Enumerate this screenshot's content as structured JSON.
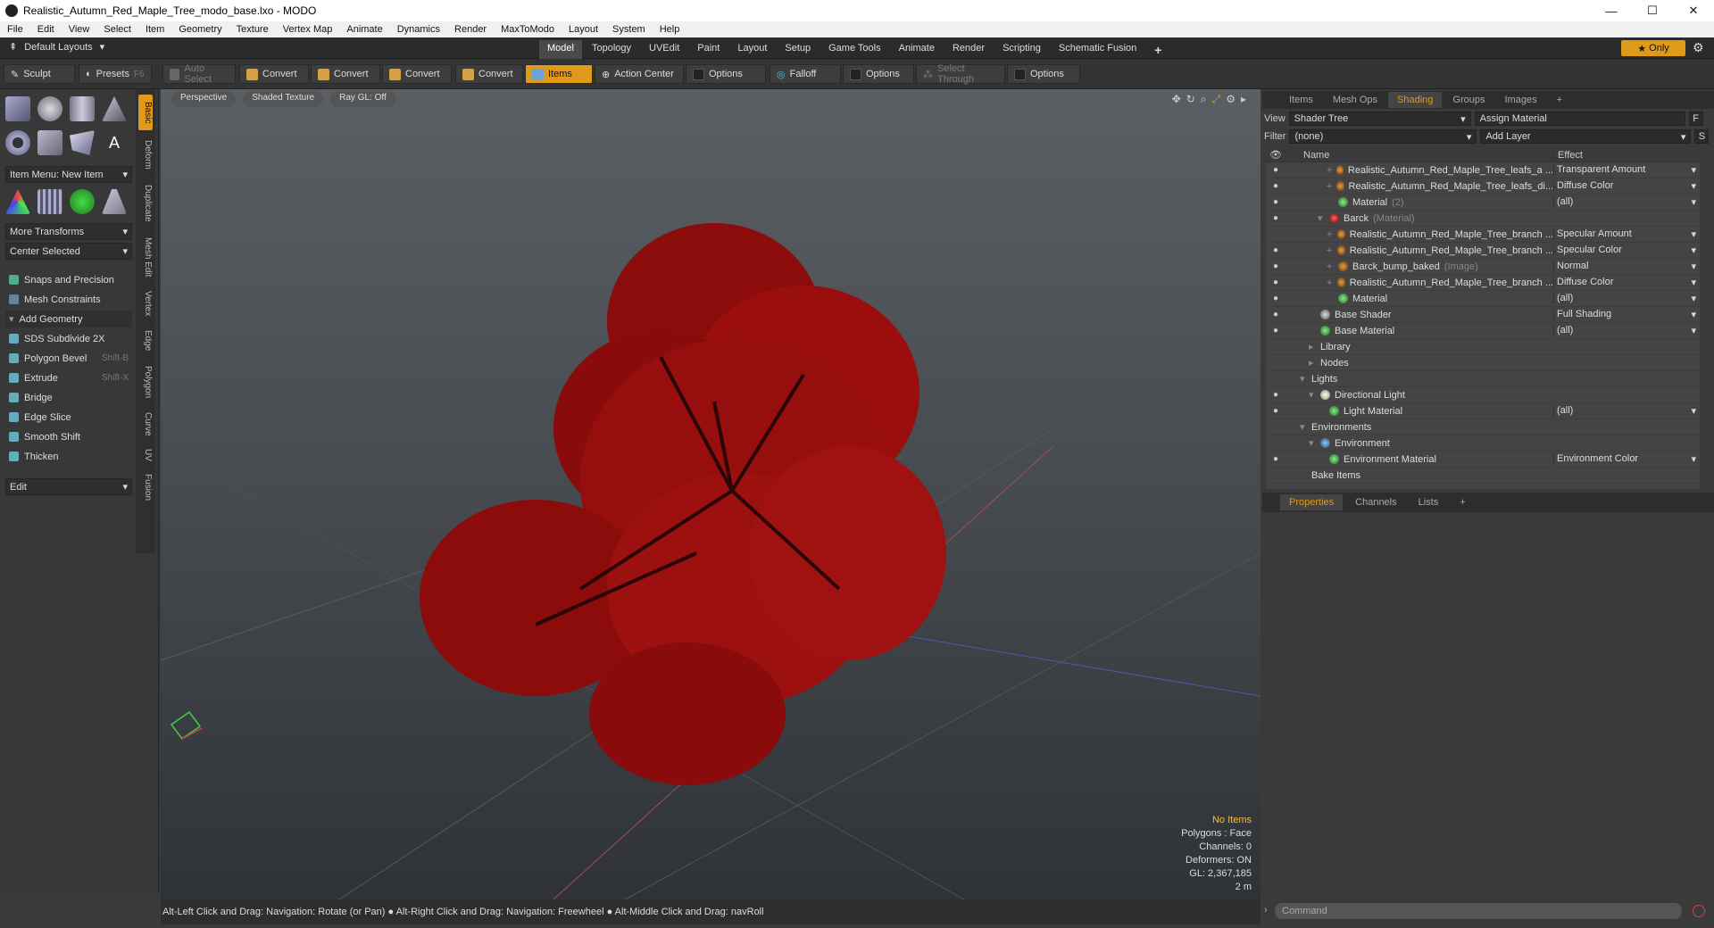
{
  "window": {
    "title": "Realistic_Autumn_Red_Maple_Tree_modo_base.lxo - MODO",
    "minimize": "—",
    "maximize": "☐",
    "close": "✕"
  },
  "menu": [
    "File",
    "Edit",
    "View",
    "Select",
    "Item",
    "Geometry",
    "Texture",
    "Vertex Map",
    "Animate",
    "Dynamics",
    "Render",
    "MaxToModo",
    "Layout",
    "System",
    "Help"
  ],
  "layouts": {
    "label": "Default Layouts",
    "tabs": [
      "Model",
      "Topology",
      "UVEdit",
      "Paint",
      "Layout",
      "Setup",
      "Game Tools",
      "Animate",
      "Render",
      "Scripting",
      "Schematic Fusion"
    ],
    "active": "Model",
    "add": "+",
    "only": "Only"
  },
  "toolbar": {
    "sculpt": "Sculpt",
    "presets": "Presets",
    "presets_key": "F6",
    "auto_select": "Auto Select",
    "convert1": "Convert",
    "convert2": "Convert",
    "convert3": "Convert",
    "convert4": "Convert",
    "items": "Items",
    "action_center": "Action Center",
    "options1": "Options",
    "falloff": "Falloff",
    "options2": "Options",
    "select_through": "Select Through",
    "options3": "Options"
  },
  "left": {
    "vtabs": [
      "Basic",
      "Deform",
      "Duplicate",
      "Mesh Edit",
      "Vertex",
      "Edge",
      "Polygon",
      "Curve",
      "UV",
      "Fusion"
    ],
    "item_menu": "Item Menu: New Item",
    "more_transforms": "More Transforms",
    "center_selected": "Center Selected",
    "snaps": "Snaps and Precision",
    "mesh_constraints": "Mesh Constraints",
    "add_geometry": "Add Geometry",
    "tools": [
      {
        "label": "SDS Subdivide 2X",
        "key": ""
      },
      {
        "label": "Polygon Bevel",
        "key": "Shift-B"
      },
      {
        "label": "Extrude",
        "key": "Shift-X"
      },
      {
        "label": "Bridge",
        "key": ""
      },
      {
        "label": "Edge Slice",
        "key": ""
      },
      {
        "label": "Smooth Shift",
        "key": ""
      },
      {
        "label": "Thicken",
        "key": ""
      }
    ],
    "edit": "Edit"
  },
  "viewport": {
    "perspective": "Perspective",
    "shading": "Shaded Texture",
    "raygl": "Ray GL: Off",
    "hud": {
      "items": "No Items",
      "polygons": "Polygons : Face",
      "channels": "Channels: 0",
      "deformers": "Deformers: ON",
      "gl": "GL: 2,367,185",
      "scale": "2 m"
    }
  },
  "status": "Alt-Left Click and Drag: Navigation: Rotate (or Pan) ● Alt-Right Click and Drag: Navigation: Freewheel ● Alt-Middle Click and Drag: navRoll",
  "right": {
    "tabs": [
      "Items",
      "Mesh Ops",
      "Shading",
      "Groups",
      "Images"
    ],
    "active_tab": "Shading",
    "view_label": "View",
    "view_value": "Shader Tree",
    "assign_material": "Assign Material",
    "f_btn": "F",
    "filter_label": "Filter",
    "filter_value": "(none)",
    "add_layer": "Add Layer",
    "s_btn": "S",
    "col_name": "Name",
    "col_effect": "Effect",
    "rows": [
      {
        "indent": 4,
        "name": "Realistic_Autumn_Red_Maple_Tree_leafs_a ...",
        "sub": "",
        "effect": "Transparent Amount",
        "kind": "tex",
        "eye": true
      },
      {
        "indent": 4,
        "name": "Realistic_Autumn_Red_Maple_Tree_leafs_di...",
        "sub": "",
        "effect": "Diffuse Color",
        "kind": "tex",
        "eye": true
      },
      {
        "indent": 4,
        "name": "Material",
        "sub": "(2)",
        "effect": "(all)",
        "kind": "mat",
        "eye": true
      },
      {
        "indent": 3,
        "name": "Barck",
        "sub": "(Material)",
        "effect": "",
        "kind": "grp",
        "eye": true
      },
      {
        "indent": 4,
        "name": "Realistic_Autumn_Red_Maple_Tree_branch ...",
        "sub": "",
        "effect": "Specular Amount",
        "kind": "tex",
        "eye": false
      },
      {
        "indent": 4,
        "name": "Realistic_Autumn_Red_Maple_Tree_branch ...",
        "sub": "",
        "effect": "Specular Color",
        "kind": "tex",
        "eye": true
      },
      {
        "indent": 4,
        "name": "Barck_bump_baked",
        "sub": "(Image)",
        "effect": "Normal",
        "kind": "tex",
        "eye": true
      },
      {
        "indent": 4,
        "name": "Realistic_Autumn_Red_Maple_Tree_branch ...",
        "sub": "",
        "effect": "Diffuse Color",
        "kind": "tex",
        "eye": true
      },
      {
        "indent": 4,
        "name": "Material",
        "sub": "",
        "effect": "(all)",
        "kind": "mat",
        "eye": true
      },
      {
        "indent": 2,
        "name": "Base Shader",
        "sub": "",
        "effect": "Full Shading",
        "kind": "shader",
        "eye": true
      },
      {
        "indent": 2,
        "name": "Base Material",
        "sub": "",
        "effect": "(all)",
        "kind": "mat",
        "eye": true
      },
      {
        "indent": 2,
        "name": "Library",
        "sub": "",
        "effect": "",
        "kind": "folder",
        "eye": false
      },
      {
        "indent": 2,
        "name": "Nodes",
        "sub": "",
        "effect": "",
        "kind": "folder",
        "eye": false
      },
      {
        "indent": 1,
        "name": "Lights",
        "sub": "",
        "effect": "",
        "kind": "none",
        "eye": false
      },
      {
        "indent": 2,
        "name": "Directional Light",
        "sub": "",
        "effect": "",
        "kind": "light",
        "eye": true
      },
      {
        "indent": 3,
        "name": "Light Material",
        "sub": "",
        "effect": "(all)",
        "kind": "mat",
        "eye": true
      },
      {
        "indent": 1,
        "name": "Environments",
        "sub": "",
        "effect": "",
        "kind": "none",
        "eye": false
      },
      {
        "indent": 2,
        "name": "Environment",
        "sub": "",
        "effect": "",
        "kind": "env",
        "eye": false
      },
      {
        "indent": 3,
        "name": "Environment Material",
        "sub": "",
        "effect": "Environment Color",
        "kind": "mat",
        "eye": true
      },
      {
        "indent": 1,
        "name": "Bake Items",
        "sub": "",
        "effect": "",
        "kind": "none",
        "eye": false
      }
    ],
    "props_tabs": [
      "Properties",
      "Channels",
      "Lists"
    ],
    "props_add": "+",
    "command_placeholder": "Command"
  },
  "colors": {
    "accent": "#e09a1a",
    "tree_red": "#a81010"
  }
}
